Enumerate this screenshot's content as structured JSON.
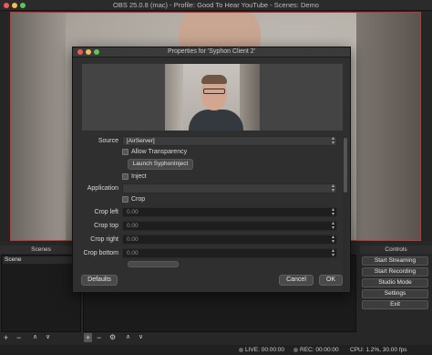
{
  "app": {
    "window_title": "OBS 25.0.8 (mac) - Profile: Good To Hear YouTube - Scenes: Demo"
  },
  "dialog": {
    "title": "Properties for 'Syphon Client 2'",
    "source_label": "Source",
    "source_value": "[AirServer]",
    "allow_transparency_label": "Allow Transparency",
    "launch_button": "Launch SyphonInject",
    "inject_label": "Inject",
    "application_label": "Application",
    "application_value": "",
    "crop_label": "Crop",
    "crop_left_label": "Crop left",
    "crop_left_value": "0.00",
    "crop_top_label": "Crop top",
    "crop_top_value": "0.00",
    "crop_right_label": "Crop right",
    "crop_right_value": "0.00",
    "crop_bottom_label": "Crop bottom",
    "crop_bottom_value": "0.00",
    "defaults_button": "Defaults",
    "cancel_button": "Cancel",
    "ok_button": "OK"
  },
  "docks": {
    "scenes_title": "Scenes",
    "scene_item": "Scene",
    "controls_title": "Controls",
    "controls": [
      "Start Streaming",
      "Start Recording",
      "Studio Mode",
      "Settings",
      "Exit"
    ]
  },
  "status": {
    "live": "LIVE: 00:00:00",
    "rec": "REC: 00:00:00",
    "cpu": "CPU: 1.2%, 30.00 fps"
  },
  "colors": {
    "preview_border": "#cc3333"
  }
}
